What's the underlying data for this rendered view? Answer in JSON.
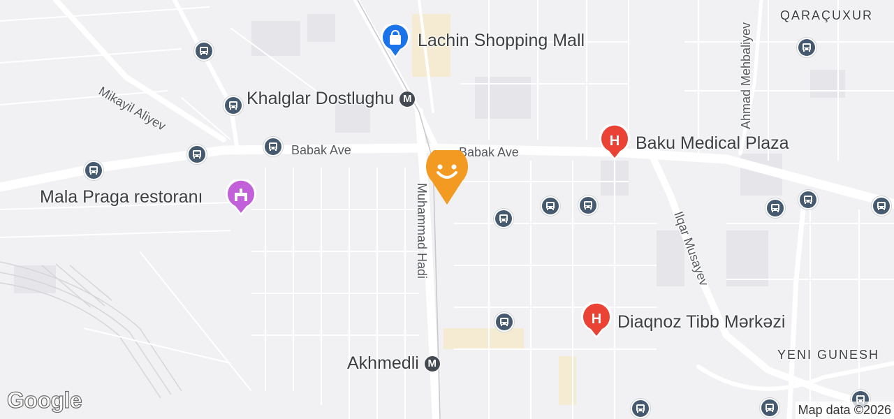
{
  "map": {
    "pois": [
      {
        "name": "Lachin Shopping Mall",
        "type": "shopping"
      },
      {
        "name": "Baku Medical Plaza",
        "type": "hospital"
      },
      {
        "name": "Mala Praga restoranı",
        "type": "restaurant"
      },
      {
        "name": "Diaqnoz Tibb Mərkəzi",
        "type": "hospital"
      }
    ],
    "metro_stations": [
      {
        "name": "Khalglar Dostlughu",
        "icon": "M"
      },
      {
        "name": "Akhmedli",
        "icon": "M"
      }
    ],
    "roads": {
      "babak_west": "Babak Ave",
      "babak_east": "Babak Ave",
      "mikayil": "Mikayil Aliyev",
      "muhammad": "Muhammad Hadi",
      "ilqar": "Ilqar Musayev",
      "ahmad": "Ahmad Mehbaliyev"
    },
    "districts": {
      "qaracuxur": "QARAÇUXUR",
      "yeni": "YENI GUNESH"
    },
    "markers": {
      "hospital": "H",
      "metro": "M"
    },
    "logo": "Google",
    "attribution": "Map data ©2026",
    "colors": {
      "hospital": "#ea4335",
      "shopping": "#1a73e8",
      "restaurant": "#c160d8",
      "location": "#f29a21",
      "bus": "#455a6e",
      "metro": "#444a52"
    }
  }
}
